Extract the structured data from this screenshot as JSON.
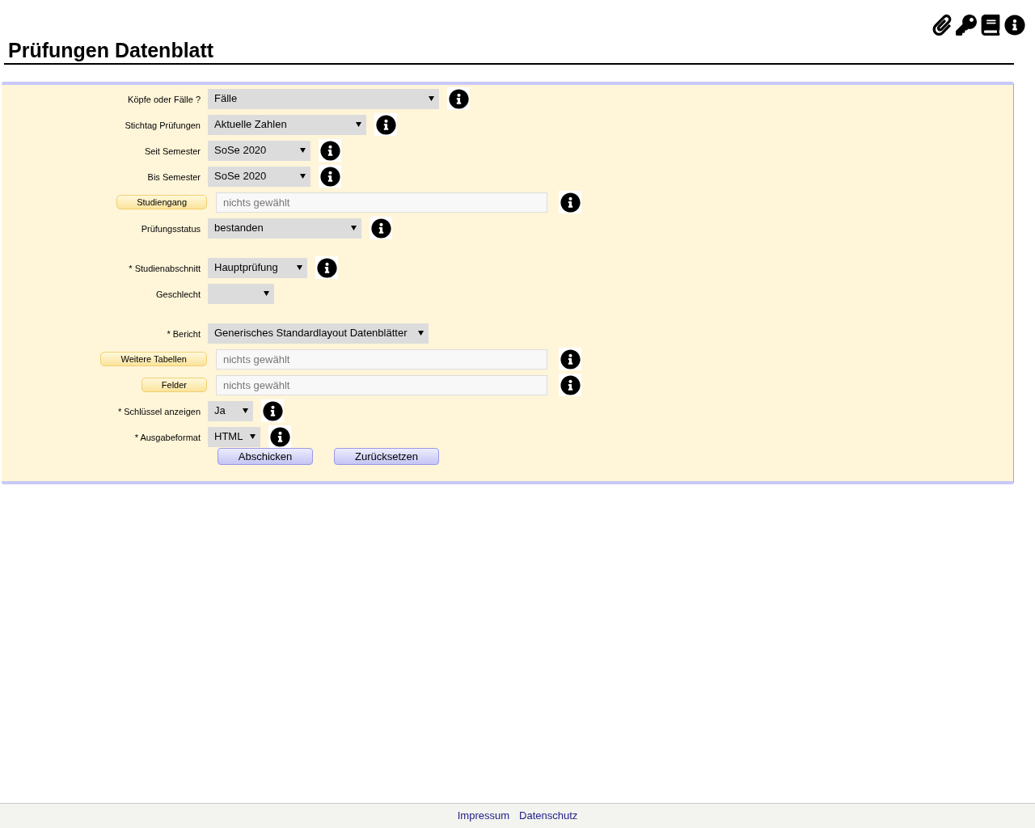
{
  "title": "Prüfungen Datenblatt",
  "rows": [
    {
      "kind": "select",
      "label": "Köpfe oder Fälle ?",
      "value": "Fälle",
      "info": true
    },
    {
      "kind": "select",
      "label": "Stichtag Prüfungen",
      "value": "Aktuelle Zahlen",
      "info": true
    },
    {
      "kind": "select",
      "label": "Seit Semester",
      "value": "SoSe 2020",
      "info": true
    },
    {
      "kind": "select",
      "label": "Bis Semester",
      "value": "SoSe 2020",
      "info": true
    },
    {
      "kind": "picker",
      "label": "Studiengang",
      "placeholder": "nichts gewählt",
      "info": true
    },
    {
      "kind": "select",
      "label": "Prüfungsstatus",
      "value": "bestanden",
      "info": true
    },
    {
      "kind": "spacer"
    },
    {
      "kind": "select",
      "label": "* Studienabschnitt",
      "value": "Hauptprüfung",
      "info": true
    },
    {
      "kind": "select",
      "label": "Geschlecht",
      "info": false
    },
    {
      "kind": "spacer"
    },
    {
      "kind": "select",
      "label": "* Bericht",
      "value": "Generisches Standardlayout Datenblätter",
      "info": false
    },
    {
      "kind": "picker",
      "label": "Weitere Tabellen",
      "placeholder": "nichts gewählt",
      "info": true
    },
    {
      "kind": "picker",
      "label": "Felder",
      "placeholder": "nichts gewählt",
      "info": true
    },
    {
      "kind": "select",
      "label": "* Schlüssel anzeigen",
      "value": "Ja",
      "info": true
    },
    {
      "kind": "select",
      "label": "* Ausgabeformat",
      "value": "HTML",
      "info": true
    }
  ],
  "buttons": [
    "Abschicken",
    "Zurücksetzen"
  ],
  "footer_links": [
    "Impressum",
    "Datenschutz"
  ]
}
